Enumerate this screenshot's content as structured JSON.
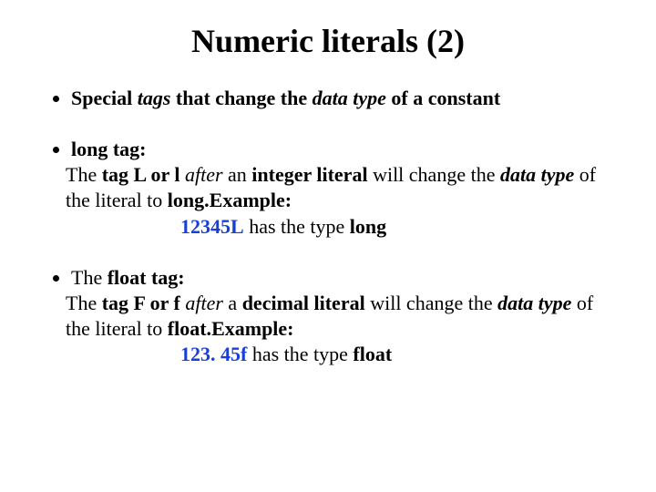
{
  "title": "Numeric literals (2)",
  "b1": {
    "lead_pre": "Special ",
    "tags": "tags",
    "lead_mid": " that change the ",
    "datatype": "data type",
    "lead_post": " of a constant"
  },
  "b2": {
    "head": "long tag:",
    "s1": "The ",
    "s2": "tag L or l ",
    "s3": "after",
    "s4": " an ",
    "s5": "integer literal",
    "s6": " will change the ",
    "s7": "data type",
    "s8": " of the literal to ",
    "s9": "long.",
    "s10": "Example:",
    "ex_code": "12345L",
    "ex_mid": " has the type ",
    "ex_type": "long"
  },
  "b3": {
    "head_pre": "The ",
    "head_b": "float tag:",
    "s1": "The ",
    "s2": "tag F or f ",
    "s3": "after",
    "s4": " a ",
    "s5": "decimal literal",
    "s6": " will change the ",
    "s7": "data type",
    "s8": " of the literal to ",
    "s9": "float.",
    "s10": "Example:",
    "ex_code": "123. 45f",
    "ex_mid": " has the type ",
    "ex_type": "float"
  }
}
